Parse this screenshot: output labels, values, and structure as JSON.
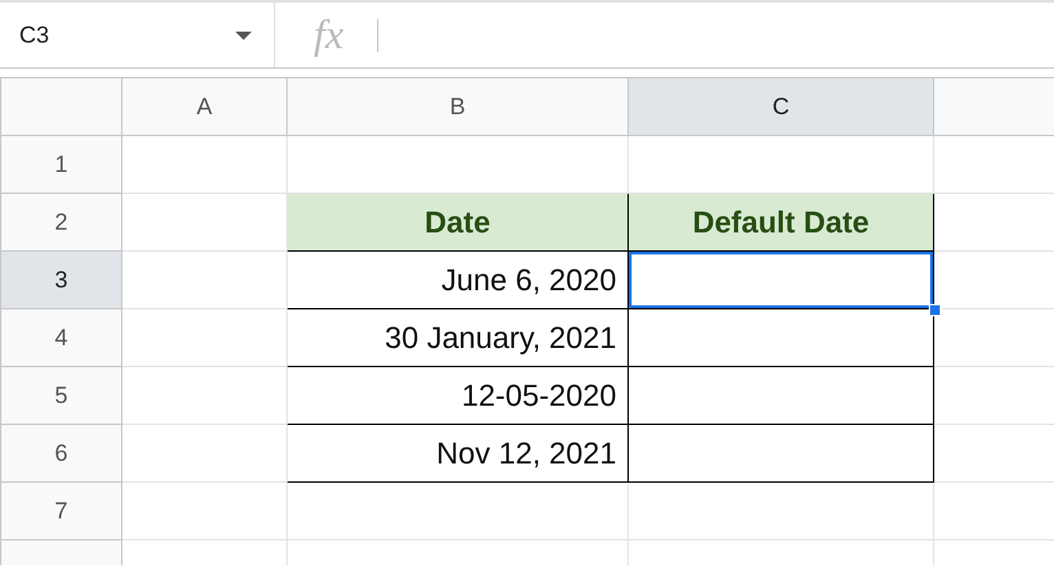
{
  "name_box": {
    "value": "C3"
  },
  "formula_bar": {
    "icon": "fx"
  },
  "columns": [
    {
      "label": "A",
      "selected": false
    },
    {
      "label": "B",
      "selected": false
    },
    {
      "label": "C",
      "selected": true
    }
  ],
  "rows": [
    {
      "label": "1",
      "selected": false,
      "cells": [
        {
          "kind": "blank",
          "selected": false
        },
        {
          "kind": "blank",
          "selected": false
        },
        {
          "kind": "blank",
          "selected": false
        }
      ]
    },
    {
      "label": "2",
      "selected": false,
      "cells": [
        {
          "kind": "blank",
          "selected": false
        },
        {
          "kind": "heading",
          "text": "Date",
          "selected": false
        },
        {
          "kind": "heading",
          "text": "Default Date",
          "selected": false
        }
      ]
    },
    {
      "label": "3",
      "selected": true,
      "cells": [
        {
          "kind": "blank",
          "selected": false
        },
        {
          "kind": "data",
          "text": "June 6, 2020",
          "selected": false
        },
        {
          "kind": "data",
          "selected": true
        }
      ]
    },
    {
      "label": "4",
      "selected": false,
      "cells": [
        {
          "kind": "blank",
          "selected": false
        },
        {
          "kind": "data",
          "text": "30 January, 2021",
          "selected": false
        },
        {
          "kind": "data",
          "selected": false
        }
      ]
    },
    {
      "label": "5",
      "selected": false,
      "cells": [
        {
          "kind": "blank",
          "selected": false
        },
        {
          "kind": "data",
          "text": "12-05-2020",
          "selected": false
        },
        {
          "kind": "data",
          "selected": false
        }
      ]
    },
    {
      "label": "6",
      "selected": false,
      "cells": [
        {
          "kind": "blank",
          "selected": false
        },
        {
          "kind": "data",
          "text": "Nov 12, 2021",
          "selected": false
        },
        {
          "kind": "data",
          "selected": false
        }
      ]
    },
    {
      "label": "7",
      "selected": false,
      "cells": [
        {
          "kind": "blank",
          "selected": false
        },
        {
          "kind": "blank",
          "selected": false
        },
        {
          "kind": "blank",
          "selected": false
        }
      ]
    }
  ]
}
